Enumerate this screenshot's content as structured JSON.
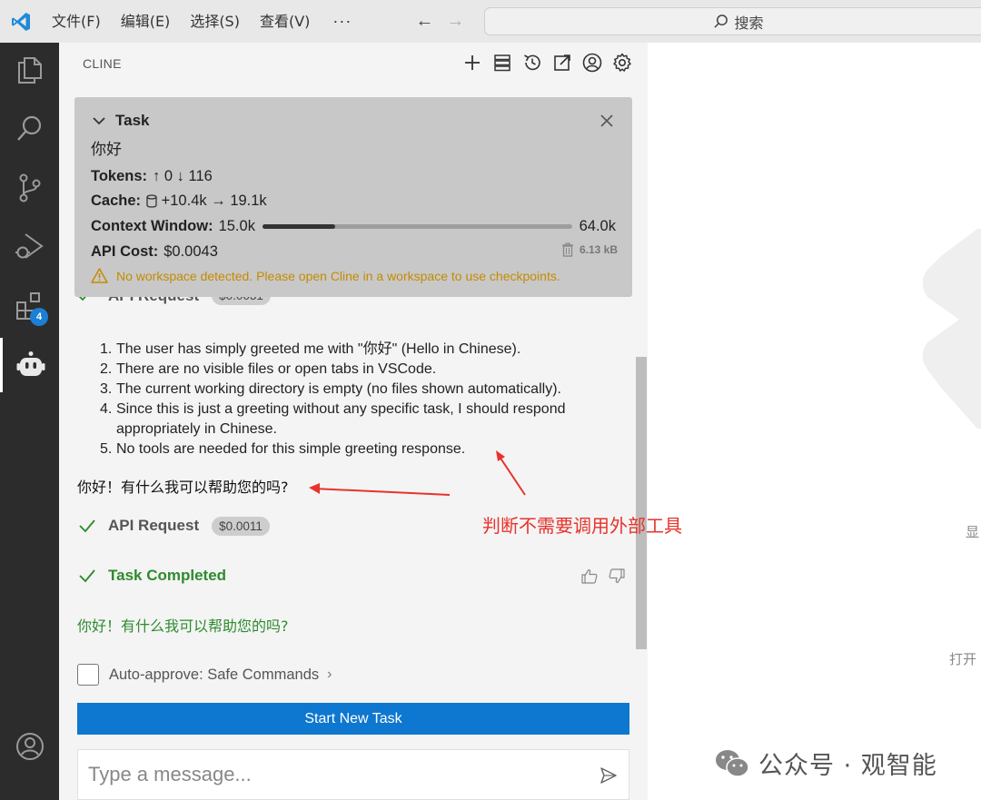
{
  "titlebar": {
    "menus": [
      "文件(F)",
      "编辑(E)",
      "选择(S)",
      "查看(V)"
    ],
    "more": "···",
    "search_label": "搜索"
  },
  "activity": {
    "extensions_badge": "4"
  },
  "panel": {
    "title": "CLINE"
  },
  "task": {
    "title": "Task",
    "text": "你好",
    "tokens_label": "Tokens:",
    "tokens_up": "0",
    "tokens_down": "116",
    "cache_label": "Cache:",
    "cache_write": "+10.4k",
    "cache_read": "19.1k",
    "context_label": "Context Window:",
    "context_used": "15.0k",
    "context_max": "64.0k",
    "context_fraction": 0.234,
    "api_cost_label": "API Cost:",
    "api_cost": "$0.0043",
    "size": "6.13 kB",
    "warning": "No workspace detected. Please open Cline in a workspace to use checkpoints."
  },
  "hidden_api": {
    "label": "API Request",
    "cost": "$0.0031"
  },
  "reasoning": [
    "The user has simply greeted me with \"你好\" (Hello in Chinese).",
    "There are no visible files or open tabs in VSCode.",
    "The current working directory is empty (no files shown automatically).",
    "Since this is just a greeting without any specific task, I should respond appropriately in Chinese.",
    "No tools are needed for this simple greeting response."
  ],
  "reply": "你好！有什么我可以帮助您的吗?",
  "api_request": {
    "label": "API Request",
    "cost": "$0.0011"
  },
  "task_completed": {
    "label": "Task Completed"
  },
  "final_reply": "你好！有什么我可以帮助您的吗?",
  "auto_approve": {
    "label": "Auto-approve: Safe Commands",
    "caret": "›"
  },
  "start_button": "Start New Task",
  "message_input": {
    "placeholder": "Type a message..."
  },
  "annotation": "判断不需要调用外部工具",
  "editor": {
    "hint_1": "显",
    "hint_2": "打开"
  },
  "watermark": "公众号 · 观智能",
  "colors": {
    "accent": "#0e77cf",
    "success": "#2e8b2e",
    "warning": "#c58b00",
    "annotation": "#e8332b"
  }
}
